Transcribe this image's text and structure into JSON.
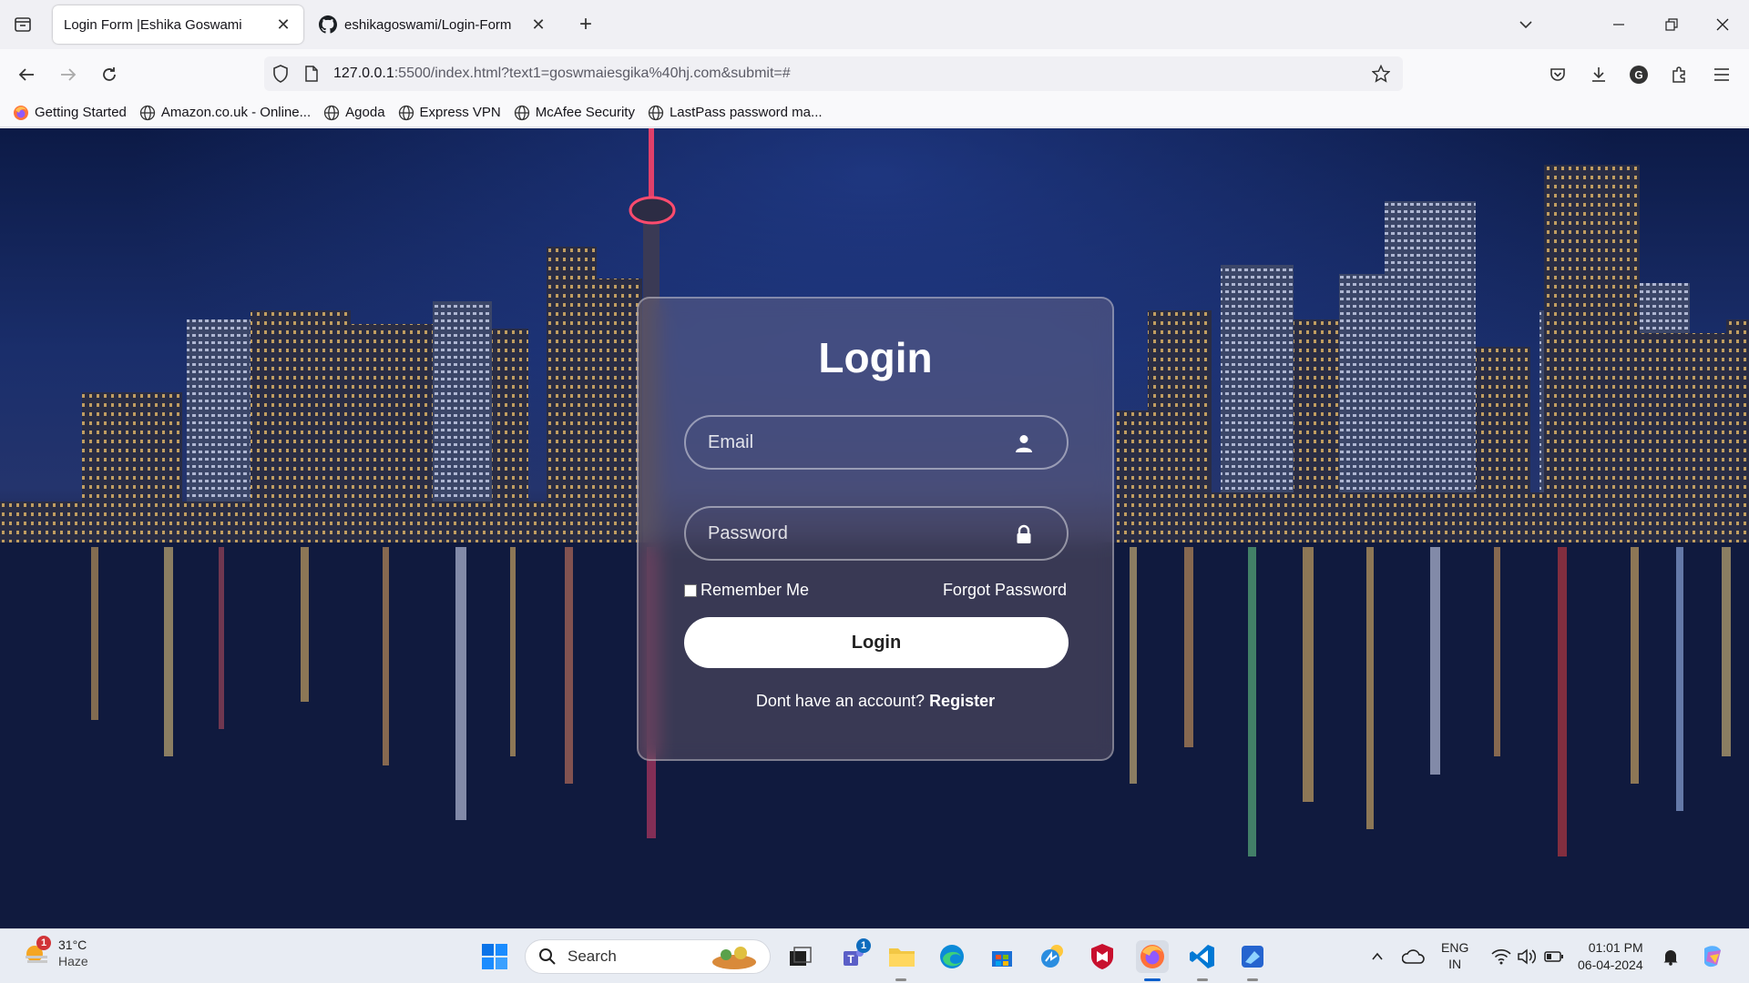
{
  "browser": {
    "tabs": [
      {
        "title": "Login Form |Eshika Goswami",
        "active": true
      },
      {
        "title": "eshikagoswami/Login-Form",
        "active": false
      }
    ],
    "url_host": "127.0.0.1",
    "url_rest": ":5500/index.html?text1=goswmaiesgika%40hj.com&submit=#",
    "bookmarks": [
      {
        "label": "Getting Started",
        "icon": "firefox-icon"
      },
      {
        "label": "Amazon.co.uk - Online...",
        "icon": "globe-icon"
      },
      {
        "label": "Agoda",
        "icon": "globe-icon"
      },
      {
        "label": "Express VPN",
        "icon": "globe-icon"
      },
      {
        "label": "McAfee Security",
        "icon": "globe-icon"
      },
      {
        "label": "LastPass password ma...",
        "icon": "globe-icon"
      }
    ]
  },
  "login": {
    "title": "Login",
    "email_placeholder": "Email",
    "password_placeholder": "Password",
    "remember_label": "Remember Me",
    "forgot_label": "Forgot Password",
    "button_label": "Login",
    "register_prompt": "Dont have an account?",
    "register_link": "Register"
  },
  "taskbar": {
    "weather_temp": "31°C",
    "weather_cond": "Haze",
    "weather_badge": "1",
    "search_label": "Search",
    "teams_badge": "1",
    "lang_top": "ENG",
    "lang_bottom": "IN",
    "time": "01:01 PM",
    "date": "06-04-2024"
  },
  "colors": {
    "tab_bg": "#f0f0f4",
    "nav_bg": "#f9f9fb",
    "card_border": "rgba(255,255,255,.35)",
    "taskbar_bg": "#e8ecf3"
  }
}
